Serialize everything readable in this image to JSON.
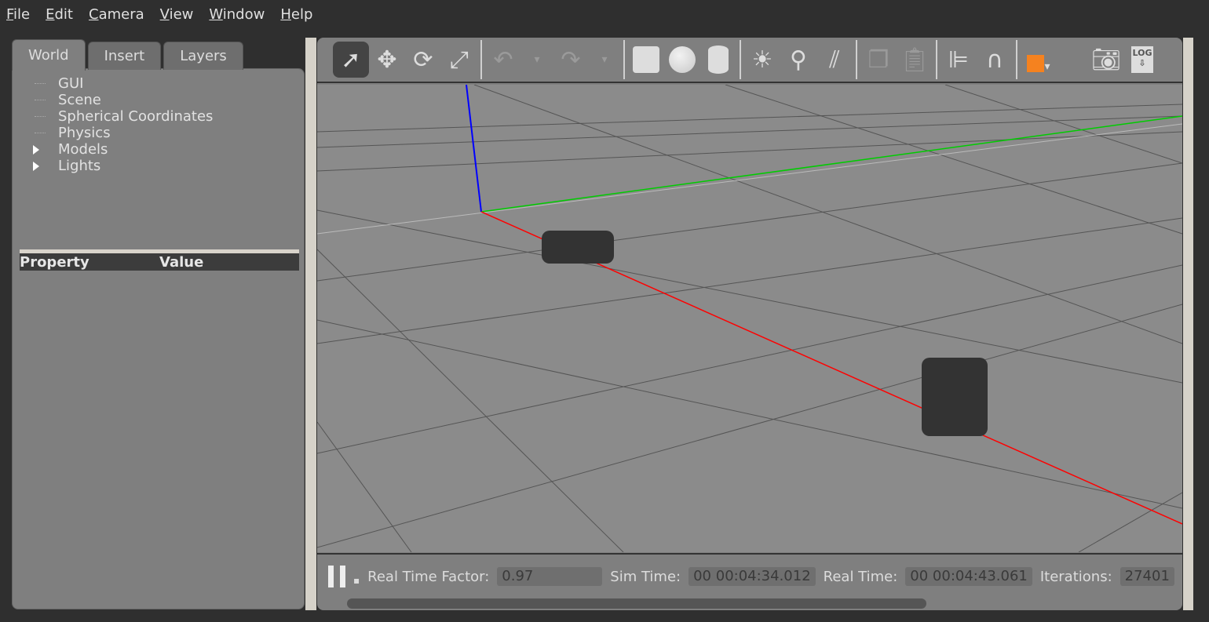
{
  "menu": [
    "File",
    "Edit",
    "Camera",
    "View",
    "Window",
    "Help"
  ],
  "tabs": [
    "World",
    "Insert",
    "Layers"
  ],
  "tree": [
    {
      "label": "GUI",
      "expandable": false
    },
    {
      "label": "Scene",
      "expandable": false
    },
    {
      "label": "Spherical Coordinates",
      "expandable": false
    },
    {
      "label": "Physics",
      "expandable": false
    },
    {
      "label": "Models",
      "expandable": true
    },
    {
      "label": "Lights",
      "expandable": true
    }
  ],
  "properties": {
    "col1": "Property",
    "col2": "Value"
  },
  "toolbar": [
    "select-arrow",
    "translate",
    "rotate",
    "scale",
    "undo",
    "undo-dropdown",
    "redo",
    "redo-dropdown",
    "box",
    "sphere",
    "cylinder",
    "point-light",
    "spot-light",
    "directional-light",
    "copy",
    "paste",
    "align",
    "snap",
    "view-angle",
    "screenshot",
    "log"
  ],
  "status": {
    "rtf_label": "Real Time Factor:",
    "rtf": "0.97",
    "sim_label": "Sim Time:",
    "sim": "00 00:04:34.012",
    "real_label": "Real Time:",
    "real": "00 00:04:43.061",
    "iter_label": "Iterations:",
    "iter": "27401"
  },
  "colors": {
    "x_axis": "#ff0000",
    "y_axis": "#00cc00",
    "z_axis": "#0000ff",
    "accent": "#f5821f"
  }
}
